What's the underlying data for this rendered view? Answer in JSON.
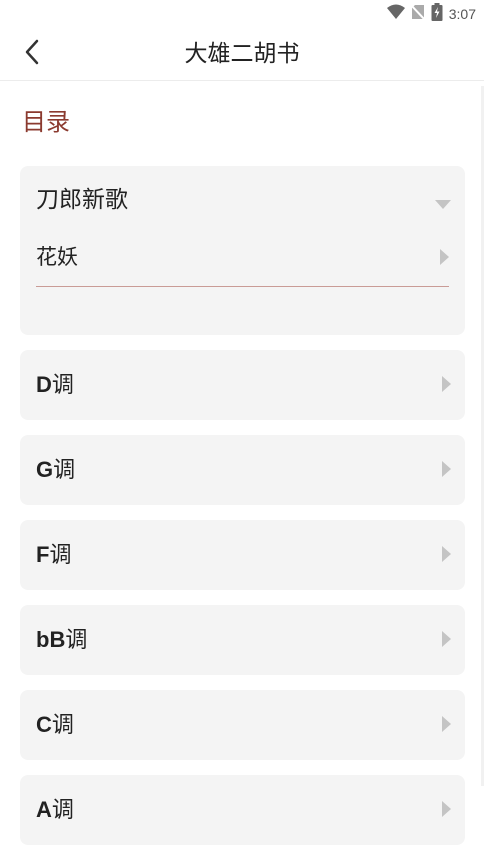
{
  "status_bar": {
    "time": "3:07",
    "icons": [
      "wifi-icon",
      "no-sim-icon",
      "battery-charging-icon"
    ]
  },
  "app_bar": {
    "title": "大雄二胡书",
    "back_icon": "back-arrow-icon"
  },
  "section_title": "目录",
  "categories": [
    {
      "title": "刀郎新歌",
      "expanded": true,
      "items": [
        "花妖"
      ]
    },
    {
      "key": "D",
      "suffix": "调"
    },
    {
      "key": "G",
      "suffix": "调"
    },
    {
      "key": "F",
      "suffix": "调"
    },
    {
      "key": "bB",
      "suffix": "调"
    },
    {
      "key": "C",
      "suffix": "调"
    },
    {
      "key": "A",
      "suffix": "调"
    }
  ],
  "colors": {
    "accent": "#8b3a2f",
    "card_bg": "#f4f4f4",
    "divider": "#c99b96",
    "icon_gray": "#c4c4c4"
  }
}
